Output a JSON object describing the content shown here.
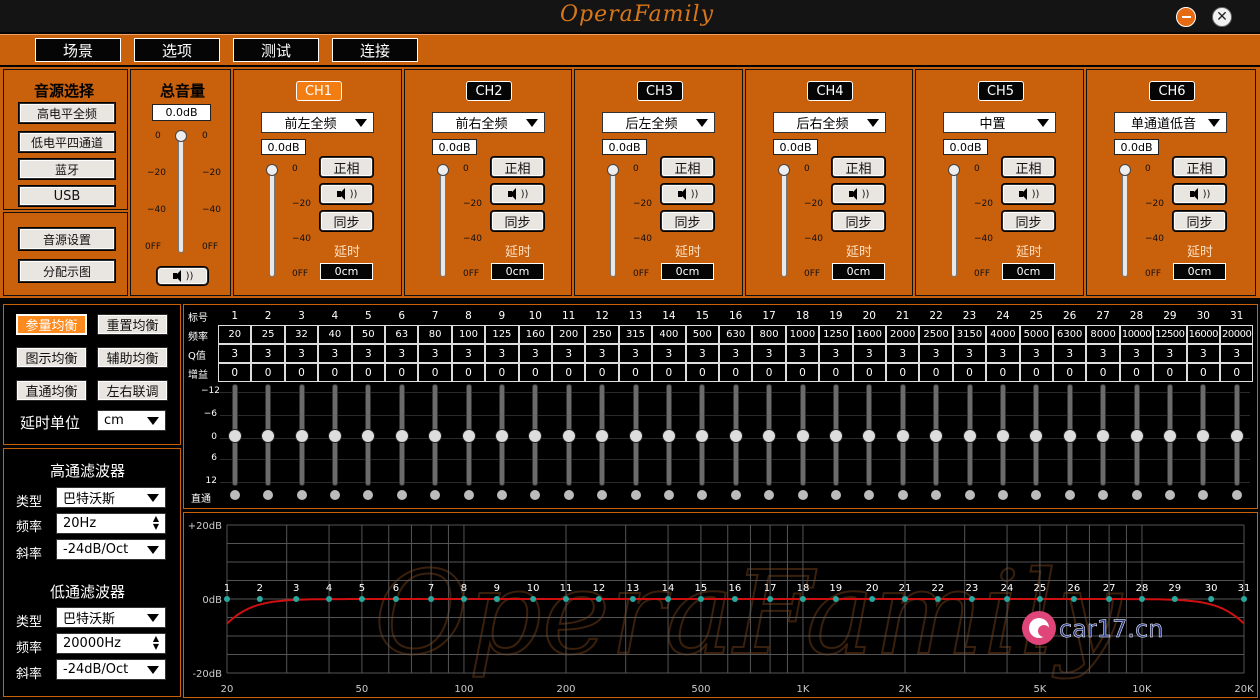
{
  "window": {
    "logo": "OperaFamily"
  },
  "menu": [
    "场景",
    "选项",
    "测试",
    "连接"
  ],
  "source": {
    "title": "音源选择",
    "buttons": [
      "高电平全频",
      "低电平四通道",
      "蓝牙",
      "USB"
    ],
    "settings": "音源设置",
    "distribution": "分配示图"
  },
  "master": {
    "title": "总音量",
    "value": "0.0dB",
    "ticks": [
      "0",
      "−20",
      "−40",
      "0FF"
    ]
  },
  "channel_common": {
    "phase": "正相",
    "sync": "同步",
    "delay_label": "延时",
    "delay_value": "0cm",
    "gain": "0.0dB",
    "ticks": [
      "0",
      "−20",
      "−40",
      "0FF"
    ]
  },
  "channels": [
    {
      "name": "CH1",
      "assign": "前左全频"
    },
    {
      "name": "CH2",
      "assign": "前右全频"
    },
    {
      "name": "CH3",
      "assign": "后左全频"
    },
    {
      "name": "CH4",
      "assign": "后右全频"
    },
    {
      "name": "CH5",
      "assign": "中置"
    },
    {
      "name": "CH6",
      "assign": "单通道低音"
    }
  ],
  "eq_modes": {
    "param": "参量均衡",
    "reset": "重置均衡",
    "graphic": "图示均衡",
    "aux": "辅助均衡",
    "bypass": "直通均衡",
    "link": "左右联调",
    "delay_unit_label": "延时单位",
    "delay_unit": "cm"
  },
  "hpf": {
    "title": "高通滤波器",
    "type_label": "类型",
    "type": "巴特沃斯",
    "freq_label": "频率",
    "freq": "20Hz",
    "slope_label": "斜率",
    "slope": "-24dB/Oct"
  },
  "lpf": {
    "title": "低通滤波器",
    "type_label": "类型",
    "type": "巴特沃斯",
    "freq_label": "频率",
    "freq": "20000Hz",
    "slope_label": "斜率",
    "slope": "-24dB/Oct"
  },
  "eq_table": {
    "row_labels": [
      "标号",
      "频率",
      "Q值",
      "增益"
    ],
    "bands": [
      "1",
      "2",
      "3",
      "4",
      "5",
      "6",
      "7",
      "8",
      "9",
      "10",
      "11",
      "12",
      "13",
      "14",
      "15",
      "16",
      "17",
      "18",
      "19",
      "20",
      "21",
      "22",
      "23",
      "24",
      "25",
      "26",
      "27",
      "28",
      "29",
      "30",
      "31"
    ],
    "freqs": [
      "20",
      "25",
      "32",
      "40",
      "50",
      "63",
      "80",
      "100",
      "125",
      "160",
      "200",
      "250",
      "315",
      "400",
      "500",
      "630",
      "800",
      "1000",
      "1250",
      "1600",
      "2000",
      "2500",
      "3150",
      "4000",
      "5000",
      "6300",
      "8000",
      "10000",
      "12500",
      "16000",
      "20000"
    ],
    "q": [
      "3",
      "3",
      "3",
      "3",
      "3",
      "3",
      "3",
      "3",
      "3",
      "3",
      "3",
      "3",
      "3",
      "3",
      "3",
      "3",
      "3",
      "3",
      "3",
      "3",
      "3",
      "3",
      "3",
      "3",
      "3",
      "3",
      "3",
      "3",
      "3",
      "3",
      "3"
    ],
    "gain": [
      "0",
      "0",
      "0",
      "0",
      "0",
      "0",
      "0",
      "0",
      "0",
      "0",
      "0",
      "0",
      "0",
      "0",
      "0",
      "0",
      "0",
      "0",
      "0",
      "0",
      "0",
      "0",
      "0",
      "0",
      "0",
      "0",
      "0",
      "0",
      "0",
      "0",
      "0"
    ],
    "slider_scale": [
      "−12",
      "−6",
      "0",
      "6",
      "12"
    ],
    "bypass_label": "直通"
  },
  "graph": {
    "y_labels": [
      "+20dB",
      "0dB",
      "-20dB"
    ],
    "x_labels": [
      "20",
      "50",
      "100",
      "200",
      "500",
      "1K",
      "2K",
      "5K",
      "10K",
      "20K"
    ],
    "watermark": "OperaFamily",
    "badge": "car17.cn"
  }
}
